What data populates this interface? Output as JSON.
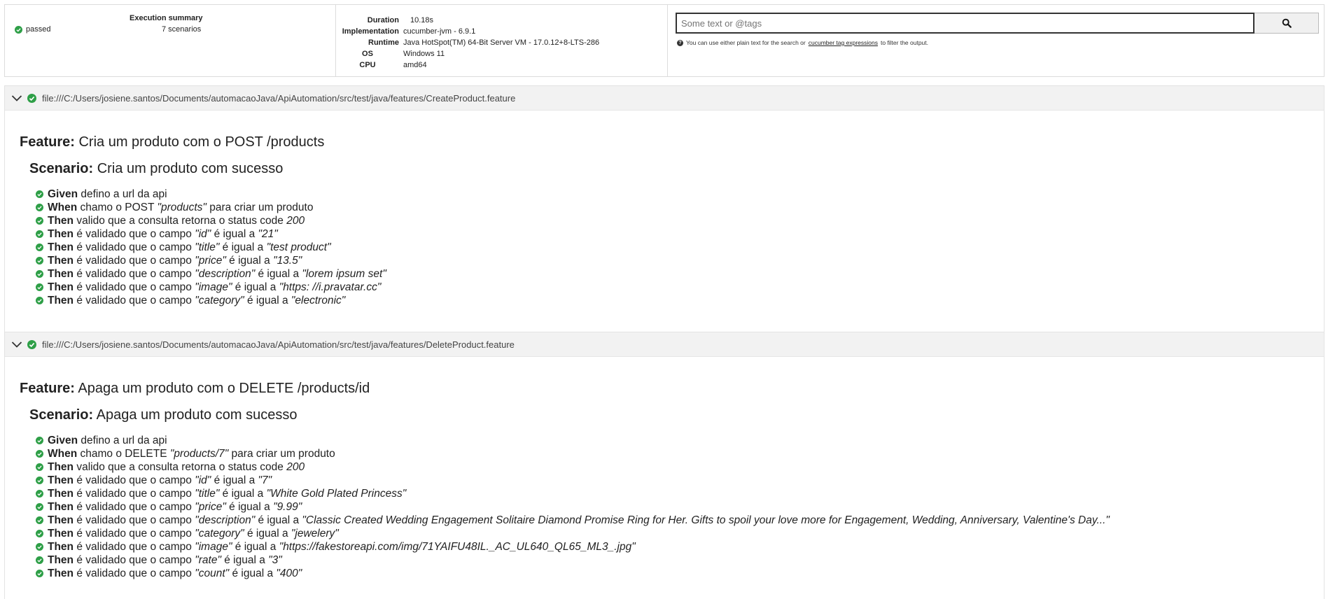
{
  "summary": {
    "status": "passed",
    "execution_title": "Execution summary",
    "scenario_count": "7 scenarios",
    "env": [
      {
        "key": "Duration",
        "value": "10.18s"
      },
      {
        "key": "Implementation",
        "value": "cucumber-jvm - 6.9.1"
      },
      {
        "key": "Runtime",
        "value": "Java HotSpot(TM) 64-Bit Server VM - 17.0.12+8-LTS-286"
      },
      {
        "key": "OS",
        "value": "Windows 11"
      },
      {
        "key": "CPU",
        "value": "amd64"
      }
    ]
  },
  "search": {
    "placeholder": "Some text or @tags",
    "button_icon": "search-icon",
    "help_prefix": "You can use either plain text for the search or",
    "help_link": "cucumber tag expressions",
    "help_suffix": "to filter the output."
  },
  "colors": {
    "passed": "#2e9f47",
    "header_bg": "#f2f2f2"
  },
  "features": [
    {
      "uri": "file:///C:/Users/josiene.santos/Documents/automacaoJava/ApiAutomation/src/test/java/features/CreateProduct.feature",
      "keyword": "Feature:",
      "name": "Cria um produto com o POST /products",
      "scenario_keyword": "Scenario:",
      "scenario_name": "Cria um produto com sucesso",
      "steps": [
        {
          "keyword": "Given",
          "parts": [
            {
              "t": " defino a url da api"
            }
          ]
        },
        {
          "keyword": "When",
          "parts": [
            {
              "t": " chamo o POST "
            },
            {
              "t": "\"products\"",
              "i": true
            },
            {
              "t": " para criar um produto"
            }
          ]
        },
        {
          "keyword": "Then",
          "parts": [
            {
              "t": " valido que a consulta retorna o status code "
            },
            {
              "t": "200",
              "i": true
            }
          ]
        },
        {
          "keyword": "Then",
          "parts": [
            {
              "t": " é validado que o campo "
            },
            {
              "t": "\"id\"",
              "i": true
            },
            {
              "t": " é igual a "
            },
            {
              "t": "\"21\"",
              "i": true
            }
          ]
        },
        {
          "keyword": "Then",
          "parts": [
            {
              "t": " é validado que o campo "
            },
            {
              "t": "\"title\"",
              "i": true
            },
            {
              "t": " é igual a "
            },
            {
              "t": "\"test product\"",
              "i": true
            }
          ]
        },
        {
          "keyword": "Then",
          "parts": [
            {
              "t": " é validado que o campo "
            },
            {
              "t": "\"price\"",
              "i": true
            },
            {
              "t": " é igual a "
            },
            {
              "t": "\"13.5\"",
              "i": true
            }
          ]
        },
        {
          "keyword": "Then",
          "parts": [
            {
              "t": " é validado que o campo "
            },
            {
              "t": "\"description\"",
              "i": true
            },
            {
              "t": " é igual a "
            },
            {
              "t": "\"lorem ipsum set\"",
              "i": true
            }
          ]
        },
        {
          "keyword": "Then",
          "parts": [
            {
              "t": " é validado que o campo "
            },
            {
              "t": "\"image\"",
              "i": true
            },
            {
              "t": " é igual a "
            },
            {
              "t": "\"https: //i.pravatar.cc\"",
              "i": true
            }
          ]
        },
        {
          "keyword": "Then",
          "parts": [
            {
              "t": " é validado que o campo "
            },
            {
              "t": "\"category\"",
              "i": true
            },
            {
              "t": " é igual a "
            },
            {
              "t": "\"electronic\"",
              "i": true
            }
          ]
        }
      ]
    },
    {
      "uri": "file:///C:/Users/josiene.santos/Documents/automacaoJava/ApiAutomation/src/test/java/features/DeleteProduct.feature",
      "keyword": "Feature:",
      "name": "Apaga um produto com o DELETE /products/id",
      "scenario_keyword": "Scenario:",
      "scenario_name": "Apaga um produto com sucesso",
      "steps": [
        {
          "keyword": "Given",
          "parts": [
            {
              "t": " defino a url da api"
            }
          ]
        },
        {
          "keyword": "When",
          "parts": [
            {
              "t": " chamo o DELETE "
            },
            {
              "t": "\"products/7\"",
              "i": true
            },
            {
              "t": " para criar um produto"
            }
          ]
        },
        {
          "keyword": "Then",
          "parts": [
            {
              "t": " valido que a consulta retorna o status code "
            },
            {
              "t": "200",
              "i": true
            }
          ]
        },
        {
          "keyword": "Then",
          "parts": [
            {
              "t": " é validado que o campo "
            },
            {
              "t": "\"id\"",
              "i": true
            },
            {
              "t": " é igual a "
            },
            {
              "t": "\"7\"",
              "i": true
            }
          ]
        },
        {
          "keyword": "Then",
          "parts": [
            {
              "t": " é validado que o campo "
            },
            {
              "t": "\"title\"",
              "i": true
            },
            {
              "t": " é igual a "
            },
            {
              "t": "\"White Gold Plated Princess\"",
              "i": true
            }
          ]
        },
        {
          "keyword": "Then",
          "parts": [
            {
              "t": " é validado que o campo "
            },
            {
              "t": "\"price\"",
              "i": true
            },
            {
              "t": " é igual a "
            },
            {
              "t": "\"9.99\"",
              "i": true
            }
          ]
        },
        {
          "keyword": "Then",
          "parts": [
            {
              "t": " é validado que o campo "
            },
            {
              "t": "\"description\"",
              "i": true
            },
            {
              "t": " é igual a "
            },
            {
              "t": "\"Classic Created Wedding Engagement Solitaire Diamond Promise Ring for Her. Gifts to spoil your love more for Engagement, Wedding, Anniversary, Valentine's Day...\"",
              "i": true
            }
          ]
        },
        {
          "keyword": "Then",
          "parts": [
            {
              "t": " é validado que o campo "
            },
            {
              "t": "\"category\"",
              "i": true
            },
            {
              "t": " é igual a "
            },
            {
              "t": "\"jewelery\"",
              "i": true
            }
          ]
        },
        {
          "keyword": "Then",
          "parts": [
            {
              "t": " é validado que o campo "
            },
            {
              "t": "\"image\"",
              "i": true
            },
            {
              "t": " é igual a "
            },
            {
              "t": "\"https://fakestoreapi.com/img/71YAIFU48IL._AC_UL640_QL65_ML3_.jpg\"",
              "i": true
            }
          ]
        },
        {
          "keyword": "Then",
          "parts": [
            {
              "t": " é validado que o campo "
            },
            {
              "t": "\"rate\"",
              "i": true
            },
            {
              "t": " é igual a "
            },
            {
              "t": "\"3\"",
              "i": true
            }
          ]
        },
        {
          "keyword": "Then",
          "parts": [
            {
              "t": " é validado que o campo "
            },
            {
              "t": "\"count\"",
              "i": true
            },
            {
              "t": " é igual a "
            },
            {
              "t": "\"400\"",
              "i": true
            }
          ]
        }
      ]
    }
  ]
}
